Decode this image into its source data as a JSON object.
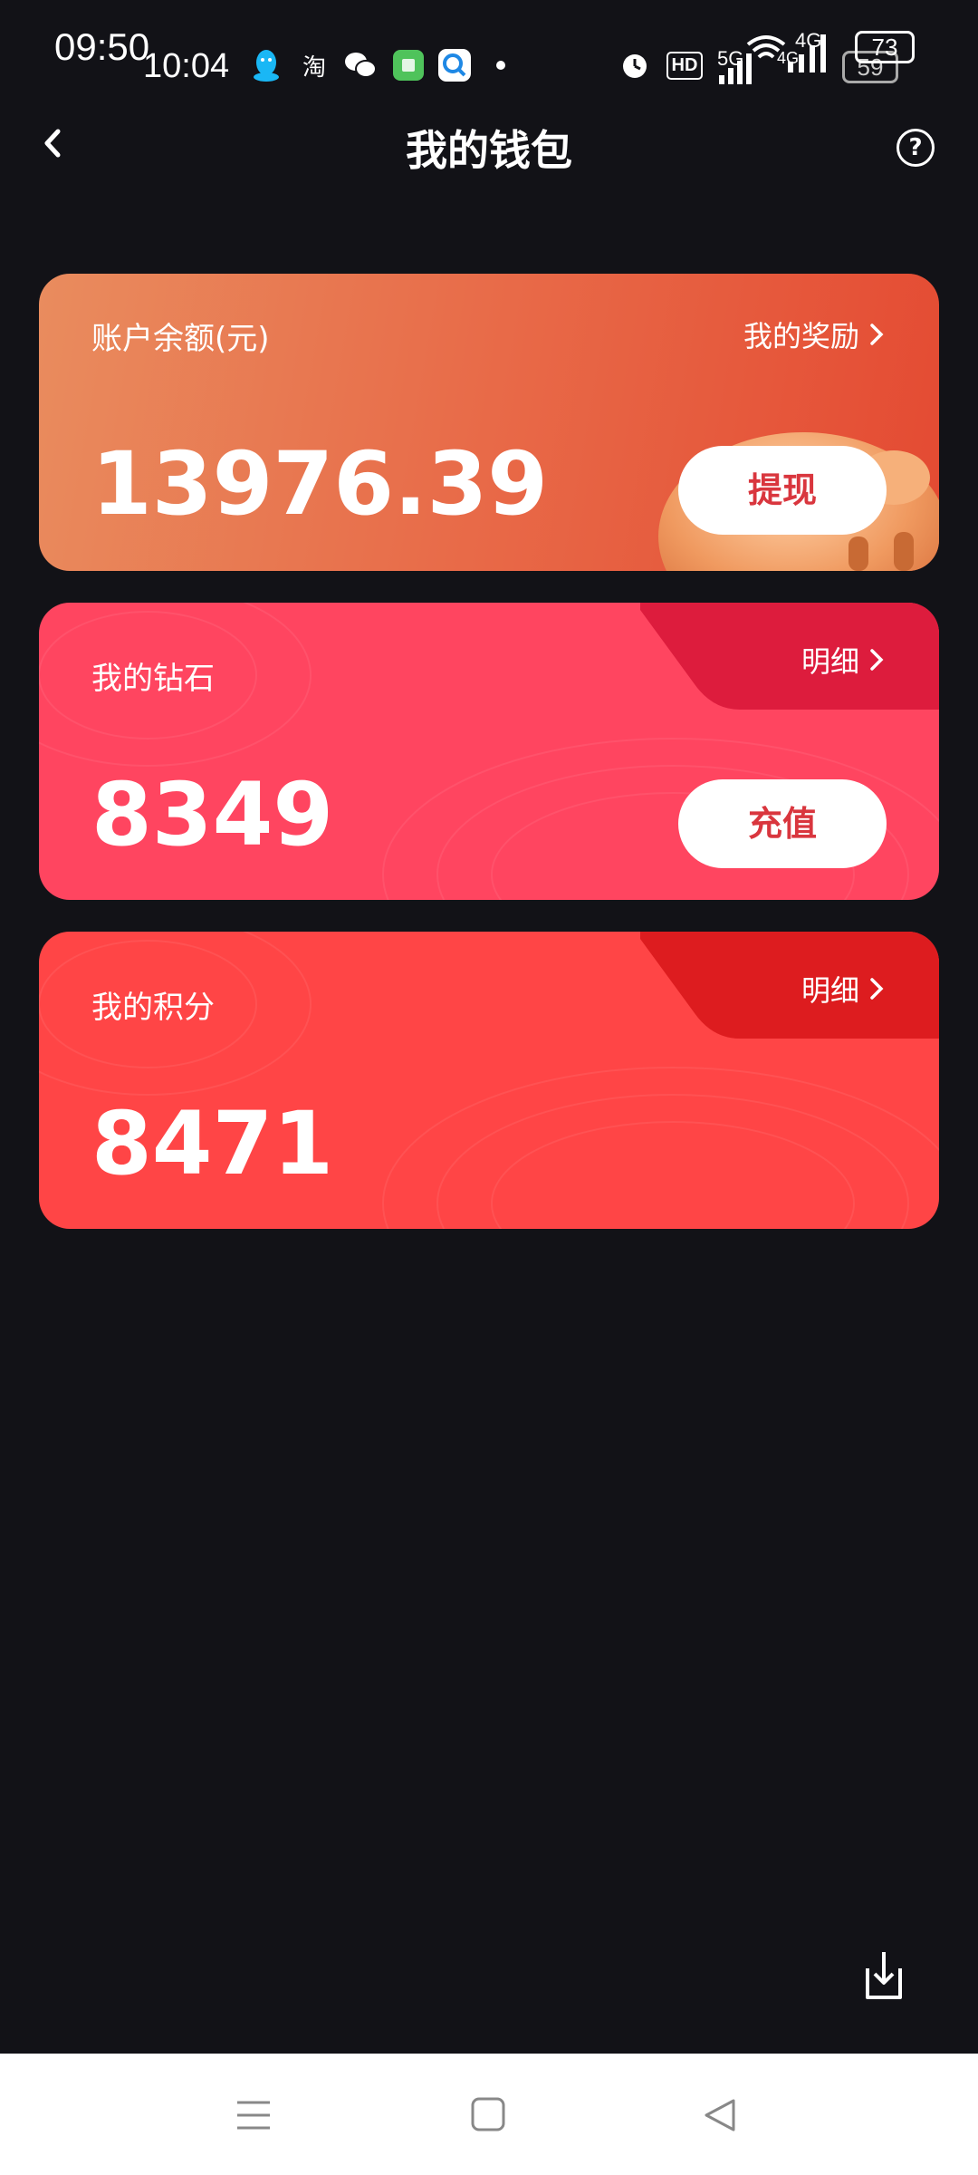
{
  "status_bar": {
    "time_back": "09:50",
    "time_front": "10:04",
    "app_icon_text": "淘",
    "hd_label": "HD",
    "net_5g": "5G",
    "net_4g_a": "4G",
    "net_4g_b": "4G",
    "battery_front": "73",
    "battery_back": "59"
  },
  "header": {
    "title": "我的钱包"
  },
  "cards": {
    "balance": {
      "label": "账户余额(元)",
      "amount": "13976.39",
      "link": "我的奖励",
      "button": "提现"
    },
    "diamond": {
      "label": "我的钻石",
      "amount": "8349",
      "link": "明细",
      "button": "充值"
    },
    "points": {
      "label": "我的积分",
      "amount": "8471",
      "link": "明细"
    }
  },
  "colors": {
    "background": "#121217",
    "balance_card": "#e86a48",
    "diamond_card": "#ff4560",
    "points_card": "#ff4546",
    "button_text_red": "#d9363e"
  }
}
